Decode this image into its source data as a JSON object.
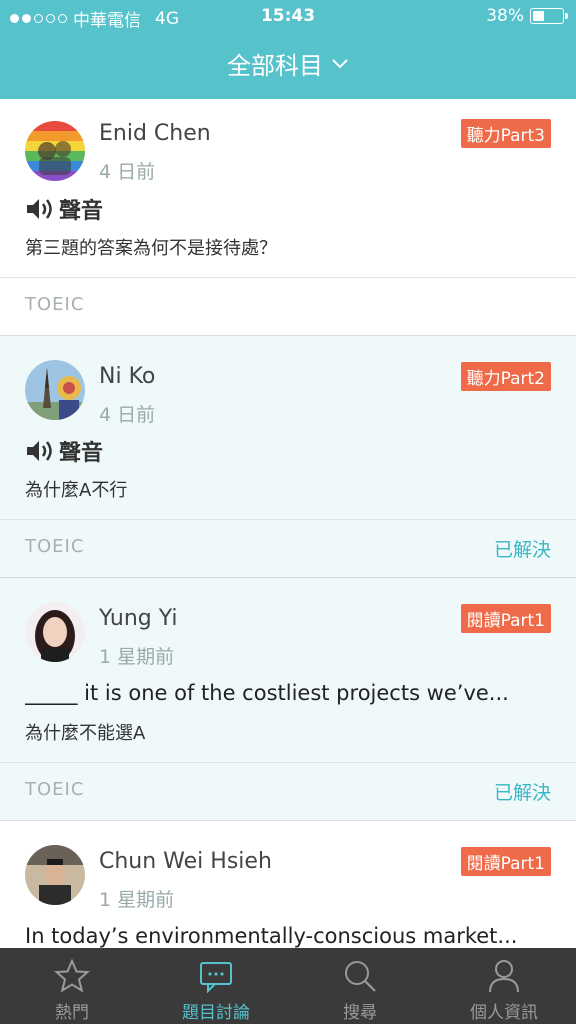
{
  "status_bar": {
    "carrier": "中華電信",
    "network": "4G",
    "time": "15:43",
    "battery": "38%",
    "battery_level": 0.38
  },
  "header": {
    "title": "全部科目",
    "dropdown_icon": "chevron-down-icon"
  },
  "posts": [
    {
      "author": "Enid Chen",
      "time_ago": "4 日前",
      "tag": "聽力Part3",
      "audio_label": "聲音",
      "question": "第三題的答案為何不是接待處？",
      "subject": "TOEIC",
      "status": ""
    },
    {
      "author": "Ni Ko",
      "time_ago": "4 日前",
      "tag": "聽力Part2",
      "audio_label": "聲音",
      "question": "為什麼A不行",
      "subject": "TOEIC",
      "status": "已解決"
    },
    {
      "author": "Yung Yi",
      "time_ago": "1 星期前",
      "tag": "閱讀Part1",
      "excerpt": "_____ it is one of the costliest projects we’ve...",
      "question": "為什麼不能選A",
      "subject": "TOEIC",
      "status": "已解決"
    },
    {
      "author": "Chun Wei Hsieh",
      "time_ago": "1 星期前",
      "tag": "閱讀Part1",
      "excerpt": "In today’s environmentally-conscious market..."
    }
  ],
  "tabbar": {
    "tabs": [
      {
        "label": "熱門",
        "icon": "star-icon"
      },
      {
        "label": "題目討論",
        "icon": "chat-bubble-icon"
      },
      {
        "label": "搜尋",
        "icon": "search-icon"
      },
      {
        "label": "個人資訊",
        "icon": "person-icon"
      }
    ],
    "active_index": 1
  },
  "colors": {
    "brand": "#56c2cc",
    "tag": "#ef6a49",
    "solved": "#39b7c4",
    "tabbar_bg": "#3a3a3a"
  }
}
